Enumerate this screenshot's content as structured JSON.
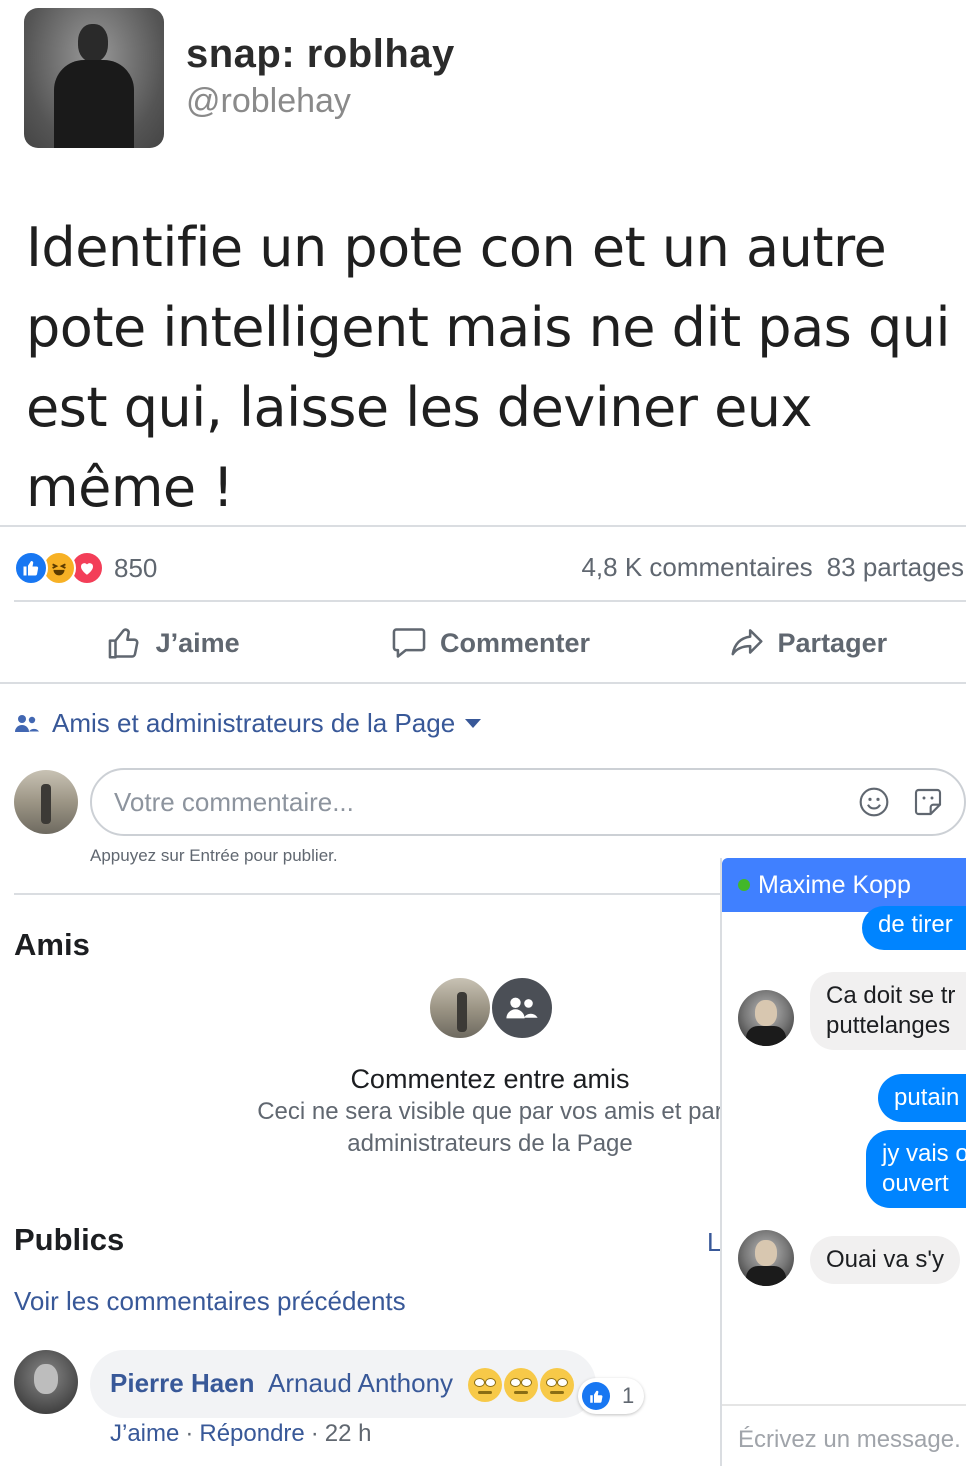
{
  "tweet": {
    "display_name": "snap: roblhay",
    "handle": "@roblehay",
    "text": "Identifie un pote con et un autre pote intelligent mais ne dit pas qui est qui, laisse les deviner eux même !"
  },
  "reactions": {
    "count": "850",
    "comments": "4,8 K commentaires",
    "shares": "83 partages"
  },
  "actions": {
    "like": "J’aime",
    "comment": "Commenter",
    "share": "Partager"
  },
  "filter": {
    "label": "Amis et administrateurs de la Page"
  },
  "composer": {
    "placeholder": "Votre commentaire...",
    "hint": "Appuyez sur Entrée pour publier."
  },
  "friends_section": {
    "title": "Amis",
    "heading": "Commentez entre amis",
    "subtext_line1": "Ceci ne sera visible que par vos amis et par",
    "subtext_line2": "administrateurs de la Page"
  },
  "public_section": {
    "title": "Publics",
    "truncated_link": "L",
    "previous_comments": "Voir les commentaires précédents"
  },
  "comment": {
    "author": "Pierre Haen",
    "text": "Arnaud Anthony",
    "like_count": "1",
    "like_label": "J’aime",
    "reply_label": "Répondre",
    "separator": "·",
    "time": "22 h"
  },
  "chat": {
    "contact": "Maxime Kopp",
    "messages": [
      {
        "dir": "out",
        "text": "de tirer"
      },
      {
        "dir": "in",
        "line1": "Ca doit se tr",
        "line2": "puttelanges"
      },
      {
        "dir": "out",
        "text": "putain"
      },
      {
        "dir": "out",
        "line1": "jy vais o",
        "line2": "ouvert"
      },
      {
        "dir": "in",
        "text": "Ouai va s'y"
      }
    ],
    "input_placeholder": "Écrivez un message."
  },
  "colors": {
    "link": "#385898",
    "chat_header": "#4080ff",
    "outgoing_bubble": "#0084ff",
    "like_blue": "#1877f2"
  },
  "icons": [
    "like-reaction-icon",
    "haha-reaction-icon",
    "love-reaction-icon",
    "thumbs-up-icon",
    "comment-bubble-icon",
    "share-arrow-icon",
    "friends-icon",
    "smiley-icon",
    "sticker-icon",
    "eye-roll-emoji-icon",
    "online-dot-icon"
  ]
}
